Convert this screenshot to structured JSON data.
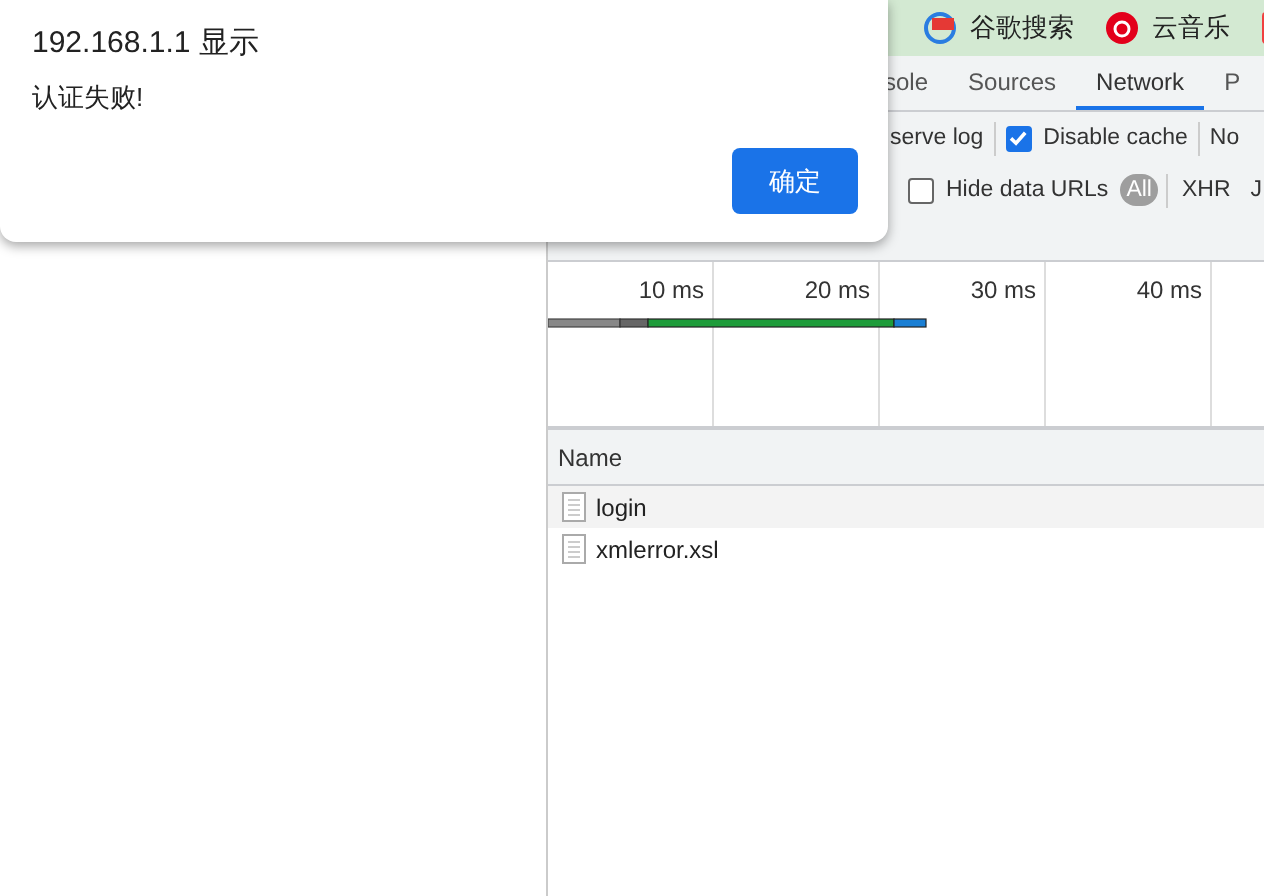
{
  "bookmarks": [
    {
      "kind": "badge-363",
      "label": "谷歌搜索"
    },
    {
      "kind": "music",
      "label": "云音乐"
    },
    {
      "kind": "red-tile"
    }
  ],
  "devtools": {
    "tabs": [
      {
        "label": "sole",
        "selected": false
      },
      {
        "label": "Sources",
        "selected": false
      },
      {
        "label": "Network",
        "selected": true
      },
      {
        "label": "P",
        "selected": false
      }
    ],
    "toolbar": [
      {
        "kind": "text",
        "label": "serve log"
      },
      {
        "kind": "checkbox",
        "label": "Disable cache",
        "checked": true
      },
      {
        "kind": "text",
        "label": "No"
      }
    ],
    "filters": [
      {
        "kind": "checkbox",
        "label": "Hide data URLs",
        "checked": false
      },
      {
        "kind": "type",
        "label": "All",
        "selected": true
      },
      {
        "kind": "type",
        "label": "XHR",
        "selected": false
      },
      {
        "kind": "type",
        "label": "J",
        "selected": false
      }
    ],
    "timeline_ticks": [
      "10 ms",
      "20 ms",
      "30 ms",
      "40 ms"
    ],
    "table": {
      "columns": [
        "Name"
      ],
      "rows": [
        {
          "name": "login",
          "highlighted": true
        },
        {
          "name": "xmlerror.xsl",
          "highlighted": false
        }
      ]
    }
  },
  "dialog": {
    "title": "192.168.1.1 显示",
    "message": "认证失败!",
    "button": "确定"
  }
}
